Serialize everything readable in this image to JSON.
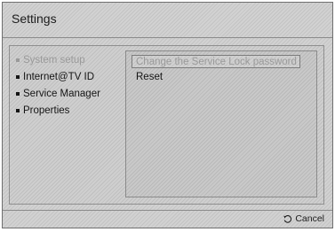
{
  "header": {
    "title": "Settings"
  },
  "menu": {
    "items": [
      {
        "label": "System setup",
        "state": "active"
      },
      {
        "label": "Internet@TV ID",
        "state": "normal"
      },
      {
        "label": "Service Manager",
        "state": "normal"
      },
      {
        "label": "Properties",
        "state": "normal"
      }
    ]
  },
  "submenu": {
    "items": [
      {
        "label": "Change the Service Lock password",
        "state": "selected"
      },
      {
        "label": "Reset",
        "state": "normal"
      }
    ]
  },
  "footer": {
    "cancel_icon": "return-icon",
    "cancel_label": "Cancel"
  }
}
